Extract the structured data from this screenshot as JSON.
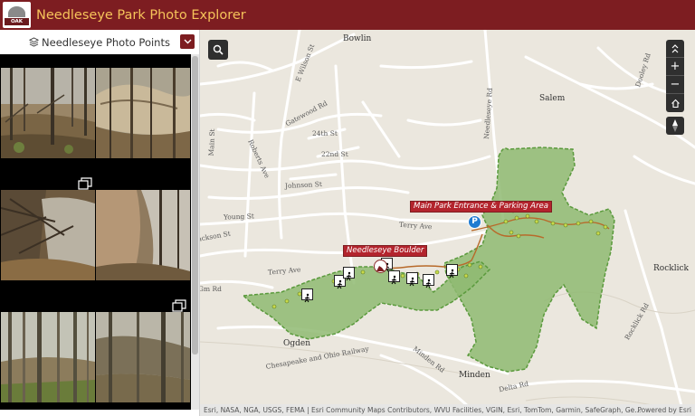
{
  "app": {
    "title": "Needleseye Park Photo Explorer",
    "logo_text": "OAK HILL",
    "header_color": "#7d1d21",
    "title_color": "#f6c35a"
  },
  "panel": {
    "title": "Needleseye Photo Points",
    "layers_icon": "layers-icon",
    "collapse_icon": "chevron-down-icon"
  },
  "gallery": {
    "photos": [
      {
        "scene": "leafy hillside with bare trees"
      },
      {
        "scene": "large sandstone rock outcrop"
      },
      {
        "scene": "boulders and fallen branches"
      },
      {
        "scene": "rock wall with tree trunks"
      },
      {
        "scene": "winter forest trees"
      },
      {
        "scene": "forest with rock ledge"
      }
    ]
  },
  "map": {
    "place_labels": [
      "Bowlin",
      "Salem",
      "Rocklick",
      "Ogden",
      "Minden"
    ],
    "street_labels": [
      "E Wilson St",
      "Gatewood Rd",
      "24th St",
      "22nd St",
      "Roberts Ave",
      "Johnson St",
      "Young St",
      "Terry Ave",
      "Terry Ave",
      "Needleseye Rd",
      "Dooley Rd",
      "Rocklick Rd",
      "Chesapeake and Ohio Railway",
      "Minden Rd",
      "Delta Rd",
      "Main St",
      "Jackson St",
      "Gm Rd"
    ],
    "callouts": [
      "Main Park Entrance & Parking Area",
      "Needleseye Boulder"
    ],
    "parking_label": "P",
    "park_fill": "#8fba72",
    "trail_color": "#b86a2a",
    "attribution": "Esri, NASA, NGA, USGS, FEMA | Esri Community Maps Contributors, WVU Facilities, VGIN, Esri, TomTom, Garmin, SafeGraph, Ge...",
    "powered_by": "Powered by Esri",
    "controls": {
      "search_icon": "search-icon",
      "expand_icon": "expand-icon",
      "zoom_in": "+",
      "zoom_out": "−",
      "home_icon": "home-icon",
      "compass_icon": "compass-icon"
    }
  }
}
